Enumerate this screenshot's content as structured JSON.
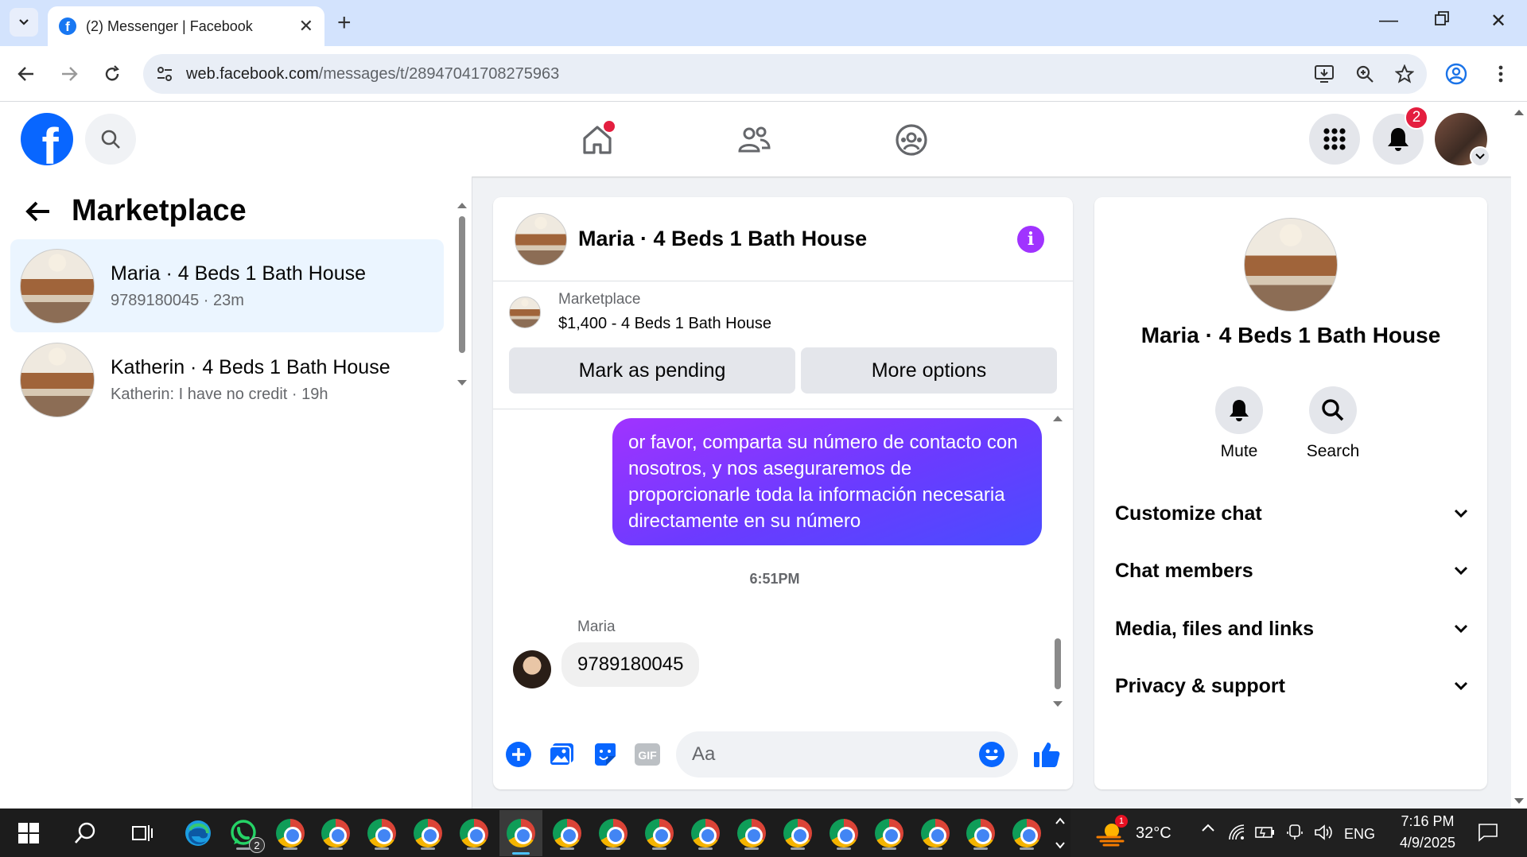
{
  "browser": {
    "tab_title": "(2) Messenger | Facebook",
    "url_domain": "web.facebook.com",
    "url_path": "/messages/t/28947041708275963"
  },
  "header": {
    "notification_count": "2",
    "accent": "#0866ff",
    "badge_color": "#e41e3f"
  },
  "sidebar": {
    "title": "Marketplace",
    "conversations": [
      {
        "name": "Maria · 4 Beds 1 Bath House",
        "preview": "9789180045",
        "time": "23m",
        "active": true
      },
      {
        "name": "Katherin · 4 Beds 1 Bath House",
        "preview": "Katherin: I have no credit",
        "time": "19h",
        "active": false
      }
    ]
  },
  "chat": {
    "title": "Maria · 4 Beds 1 Bath House",
    "listing_source": "Marketplace",
    "listing_title": "$1,400 - 4 Beds 1 Bath House",
    "mark_pending_label": "Mark as pending",
    "more_options_label": "More options",
    "outgoing_message": "or favor, comparta su número de contacto con nosotros, y nos aseguraremos de proporcionarle toda la información necesaria directamente en su número",
    "timestamp": "6:51PM",
    "incoming_sender": "Maria",
    "incoming_message": "9789180045",
    "input_placeholder": "Aa"
  },
  "info_panel": {
    "title": "Maria · 4 Beds 1 Bath House",
    "mute_label": "Mute",
    "search_label": "Search",
    "sections": [
      "Customize chat",
      "Chat members",
      "Media, files and links",
      "Privacy & support"
    ]
  },
  "taskbar": {
    "whatsapp_badge": "2",
    "weather_badge": "1",
    "temperature": "32°C",
    "language": "ENG",
    "time": "7:16 PM",
    "date": "4/9/2025"
  }
}
